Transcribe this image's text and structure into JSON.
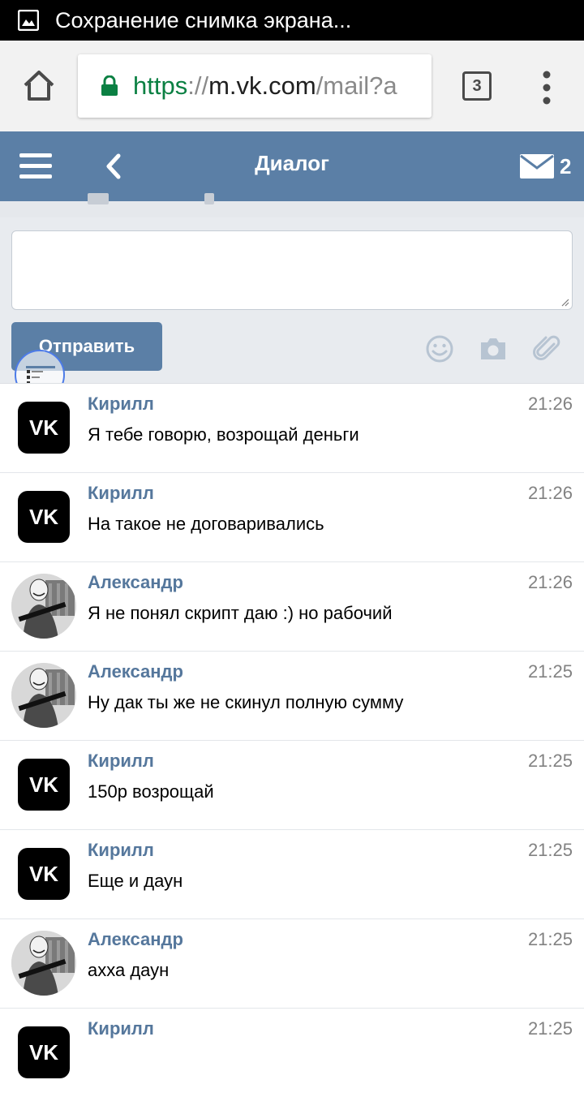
{
  "status_bar": {
    "notification": "Сохранение снимка экрана..."
  },
  "browser": {
    "url_scheme": "https",
    "url_sep": "://",
    "url_host": "m.vk.com",
    "url_rest": "/mail?a",
    "tabs_count": "3"
  },
  "header": {
    "title": "Диалог",
    "mail_count": "2"
  },
  "compose": {
    "send_label": "Отправить"
  },
  "messages": [
    {
      "author": "Кирилл",
      "time": "21:26",
      "text": "Я тебе говорю, возрощай деньги",
      "avatar": "vk-logo-icon"
    },
    {
      "author": "Кирилл",
      "time": "21:26",
      "text": "На такое не договаривались",
      "avatar": "vk-logo-icon"
    },
    {
      "author": "Александр",
      "time": "21:26",
      "text": "Я не понял скрипт даю :) но рабочий",
      "avatar": "photo"
    },
    {
      "author": "Александр",
      "time": "21:25",
      "text": "Ну дак ты же не скинул полную сумму",
      "avatar": "photo"
    },
    {
      "author": "Кирилл",
      "time": "21:25",
      "text": "150р возрощай",
      "avatar": "vk-logo-icon"
    },
    {
      "author": "Кирилл",
      "time": "21:25",
      "text": "Еще и даун",
      "avatar": "vk-logo-icon"
    },
    {
      "author": "Александр",
      "time": "21:25",
      "text": "ахха даун",
      "avatar": "photo"
    },
    {
      "author": "Кирилл",
      "time": "21:25",
      "text": "",
      "avatar": "vk-logo-icon"
    }
  ],
  "colors": {
    "vk_header": "#5b7fa6",
    "author_name": "#55779c",
    "url_green": "#0b8043",
    "compose_bg": "#e8ebef"
  }
}
